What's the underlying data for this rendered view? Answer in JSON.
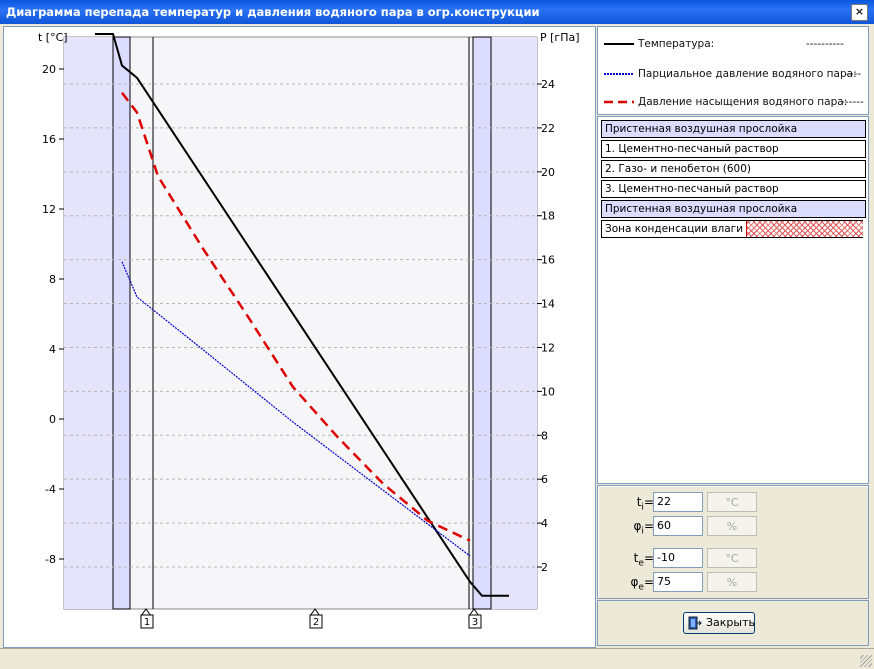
{
  "window": {
    "title": "Диаграмма перепада температур и давления водяного пара в огр.конструкции",
    "close_glyph": "×"
  },
  "chart": {
    "left_axis_label": "t [°C]",
    "right_axis_label": "P [гПа]",
    "left_ticks": [
      20,
      16,
      12,
      8,
      4,
      0,
      -4,
      -8
    ],
    "right_ticks": [
      24,
      22,
      20,
      18,
      16,
      14,
      12,
      10,
      8,
      6,
      4,
      2
    ],
    "layer_markers": [
      "1",
      "2",
      "3"
    ]
  },
  "chart_data": {
    "type": "line",
    "x": [
      0,
      1,
      2,
      3,
      4,
      5,
      6,
      7,
      8,
      9,
      10,
      11,
      12
    ],
    "series": [
      {
        "name": "Температура:",
        "axis": "left",
        "color": "#000000",
        "points": [
          [
            -0.6,
            22
          ],
          [
            0,
            22
          ],
          [
            0.3,
            20.2
          ],
          [
            0.8,
            19.5
          ],
          [
            11.9,
            -9.3
          ],
          [
            12.3,
            -10.1
          ],
          [
            13.2,
            -10.1
          ]
        ]
      },
      {
        "name": "Парциальное давление водяного пара:",
        "axis": "right",
        "color": "#0000cc",
        "points": [
          [
            0.3,
            15.9
          ],
          [
            0.8,
            14.3
          ],
          [
            3,
            11.9
          ],
          [
            6,
            8.6
          ],
          [
            9,
            5.5
          ],
          [
            11.9,
            2.5
          ]
        ]
      },
      {
        "name": "Давление насыщения водяного пара:",
        "axis": "right",
        "color": "#dd0000",
        "points": [
          [
            0.3,
            23.6
          ],
          [
            0.8,
            22.7
          ],
          [
            1.5,
            19.8
          ],
          [
            3,
            16.5
          ],
          [
            4.5,
            13.4
          ],
          [
            6,
            10.2
          ],
          [
            7.5,
            7.9
          ],
          [
            9,
            5.8
          ],
          [
            10.5,
            4.1
          ],
          [
            11.9,
            3.2
          ]
        ]
      }
    ],
    "ylim_left": [
      -11,
      23
    ],
    "ylim_right": [
      1,
      25
    ]
  },
  "legend": {
    "items": [
      {
        "label": "Температура:",
        "dashes": "----------",
        "color": "#000000",
        "style": "solid"
      },
      {
        "label": "Парциальное давление водяного пара:",
        "dashes": "----",
        "color": "#0000cc",
        "style": "dotted"
      },
      {
        "label": "Давление насыщения водяного пара:",
        "dashes": "------",
        "color": "#dd0000",
        "style": "dashed"
      }
    ]
  },
  "layers": [
    {
      "label": "Пристенная воздушная прослойка",
      "kind": "air"
    },
    {
      "label": "1. Цементно-песчаный раствор",
      "kind": "layer"
    },
    {
      "label": "2. Газо- и пенобетон (600)",
      "kind": "layer"
    },
    {
      "label": "3. Цементно-песчаный раствор",
      "kind": "layer"
    },
    {
      "label": "Пристенная воздушная прослойка",
      "kind": "air"
    }
  ],
  "condensation": {
    "label": "Зона конденсации влаги ->",
    "color": "#e05858"
  },
  "params": [
    {
      "sym": "t",
      "sub": "i",
      "value": "22",
      "unit": "°C"
    },
    {
      "sym": "φ",
      "sub": "i",
      "value": "60",
      "unit": "%"
    },
    {
      "sym": "t",
      "sub": "e",
      "value": "-10",
      "unit": "°C"
    },
    {
      "sym": "φ",
      "sub": "e",
      "value": "75",
      "unit": "%"
    }
  ],
  "close_button": {
    "label": "Закрыть"
  }
}
